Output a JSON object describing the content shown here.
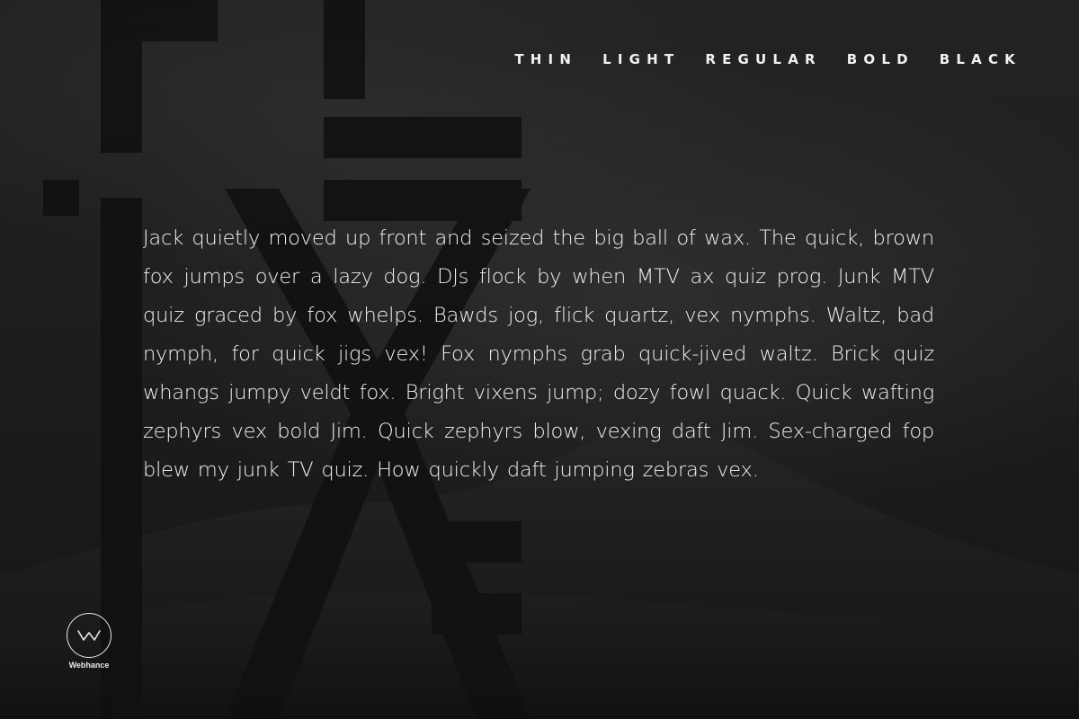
{
  "weights": [
    "THIN",
    "LIGHT",
    "REGULAR",
    "BOLD",
    "BLACK"
  ],
  "pangram": "Jack quietly moved up front and seized the big ball of wax. The quick, brown fox jumps over a lazy dog. DJs flock by when MTV ax quiz prog. Junk MTV quiz graced by fox whelps. Bawds jog, flick quartz, vex nymphs. Waltz, bad nymph, for quick jigs vex! Fox nymphs grab quick-jived waltz. Brick quiz whangs jumpy veldt fox. Bright vixens jump; dozy fowl quack. Quick wafting zephyrs vex bold Jim. Quick zephyrs blow, vexing daft Jim. Sex-charged fop blew my junk TV quiz. How quickly daft jumping zebras vex.",
  "background_word": "foxit",
  "logo": {
    "label": "Webhance",
    "icon": "w-monogram-icon"
  },
  "colors": {
    "background": "#1b1b1b",
    "text": "#f0f0f0",
    "background_letters": "#111111"
  }
}
